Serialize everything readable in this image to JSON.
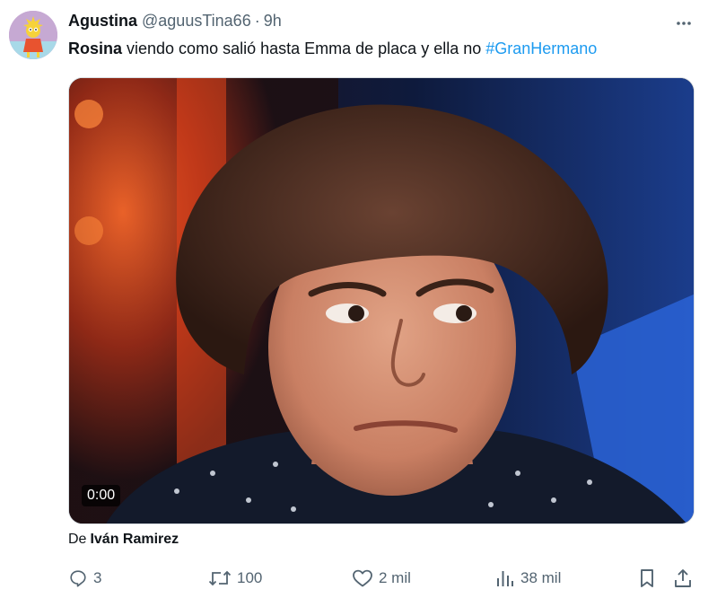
{
  "author": {
    "display_name": "Agustina",
    "handle": "@aguusTina66",
    "separator": "·",
    "time": "9h"
  },
  "tweet": {
    "mention": "Rosina",
    "text": " viendo como salió hasta Emma de placa y ella no ",
    "hashtag": "#GranHermano"
  },
  "media": {
    "video_timestamp": "0:00"
  },
  "attribution": {
    "prefix": "De",
    "name": "Iván Ramirez"
  },
  "actions": {
    "replies": "3",
    "reposts": "100",
    "likes": "2 mil",
    "views": "38 mil"
  },
  "icons": {
    "more": "more-horizontal-icon",
    "reply": "reply-icon",
    "repost": "repost-icon",
    "like": "like-icon",
    "views": "views-icon",
    "bookmark": "bookmark-icon",
    "share": "share-icon"
  },
  "colors": {
    "text_primary": "#0f1419",
    "text_secondary": "#536471",
    "link": "#1d9bf0"
  }
}
